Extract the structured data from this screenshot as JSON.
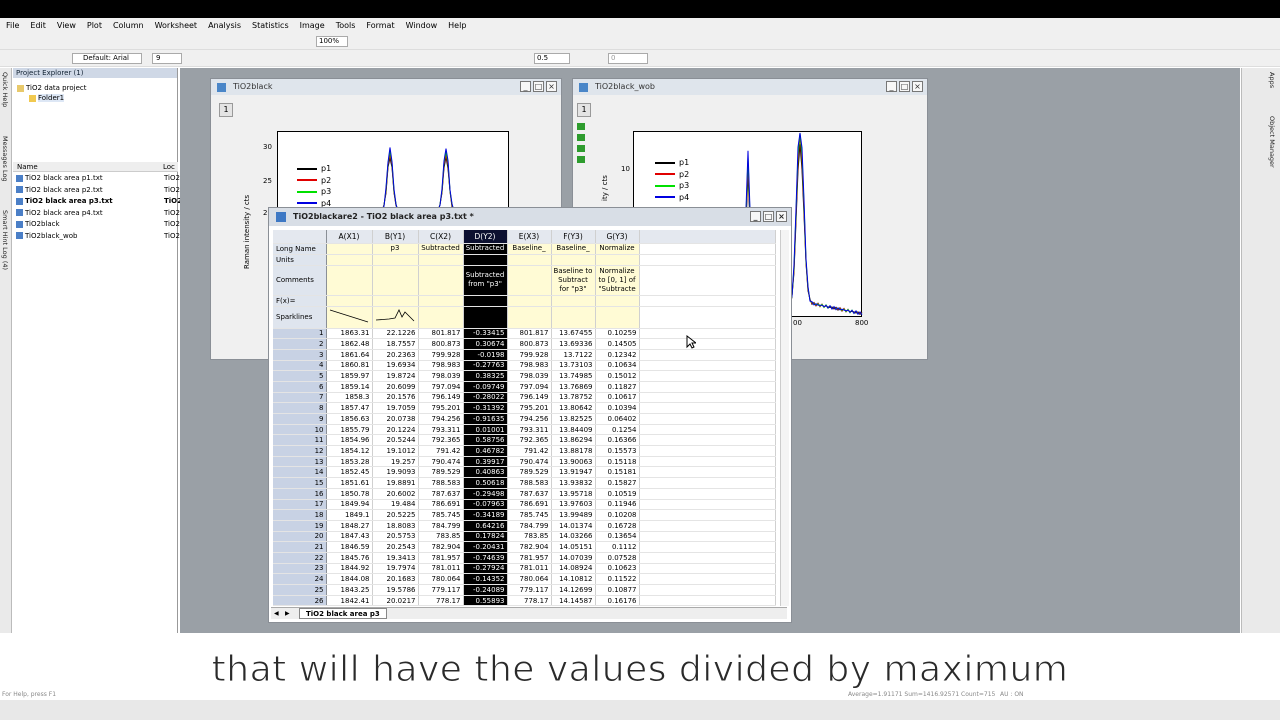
{
  "menu": [
    "File",
    "Edit",
    "View",
    "Plot",
    "Column",
    "Worksheet",
    "Analysis",
    "Statistics",
    "Image",
    "Tools",
    "Format",
    "Window",
    "Help"
  ],
  "toolbar": {
    "zoom": "100%",
    "font": "Default: Arial",
    "fontsize": "9",
    "linewidth": "0.5",
    "value": "0"
  },
  "side_labels": [
    "Quick Help",
    "Messages Log",
    "Smart Hint Log (4)"
  ],
  "right_labels": [
    "Apps",
    "Object Manager"
  ],
  "project_explorer": {
    "title": "Project Explorer (1)",
    "root": "TiO2 data project",
    "folder": "Folder1",
    "col_name": "Name",
    "col_loc": "Loc",
    "files": [
      {
        "name": "TiO2 black area p1.txt",
        "loc": "TiO2"
      },
      {
        "name": "TiO2 black area p2.txt",
        "loc": "TiO2"
      },
      {
        "name": "TiO2 black area p3.txt",
        "loc": "TiO2"
      },
      {
        "name": "TiO2 black area p4.txt",
        "loc": "TiO2"
      },
      {
        "name": "TiO2black",
        "loc": "TiO2"
      },
      {
        "name": "TiO2black_wob",
        "loc": "TiO2"
      }
    ]
  },
  "graph1": {
    "title": "TiO2black",
    "layer": "1",
    "ylabel": "Raman intensity / cts",
    "ticks": [
      "30",
      "25",
      "20"
    ],
    "legend": [
      "p1",
      "p2",
      "p3",
      "p4"
    ]
  },
  "graph2": {
    "title": "TiO2black_wob",
    "layer": "1",
    "ylabel": "ity / cts",
    "ticks": [
      "10"
    ],
    "xticks": [
      "00",
      "800"
    ],
    "legend": [
      "p1",
      "p2",
      "p3",
      "p4"
    ]
  },
  "colors": {
    "p1": "#000000",
    "p2": "#e00000",
    "p3": "#00e000",
    "p4": "#0000e0"
  },
  "worksheet": {
    "title": "TiO2blackare2 - TiO2 black area p3.txt *",
    "tab": "TiO2 black area p3",
    "columns": [
      "A(X1)",
      "B(Y1)",
      "C(X2)",
      "D(Y2)",
      "E(X3)",
      "F(Y3)",
      "G(Y3)"
    ],
    "row_labels": [
      "Long Name",
      "Units",
      "Comments",
      "F(x)=",
      "Sparklines"
    ],
    "long_names": [
      "",
      "p3",
      "Subtracted",
      "Subtracted",
      "Baseline_",
      "Baseline_",
      "Normalize"
    ],
    "comments": [
      "",
      "",
      "",
      "Subtracted from \"p3\"",
      "",
      "Baseline to Subtract for \"p3\"",
      "Normalize to [0, 1] of \"Subtracte"
    ],
    "rows": [
      [
        "1",
        "1863.31",
        "22.1226",
        "801.817",
        "-0.33415",
        "801.817",
        "13.67455",
        "0.10259"
      ],
      [
        "2",
        "1862.48",
        "18.7557",
        "800.873",
        "0.30674",
        "800.873",
        "13.69336",
        "0.14505"
      ],
      [
        "3",
        "1861.64",
        "20.2363",
        "799.928",
        "-0.0198",
        "799.928",
        "13.7122",
        "0.12342"
      ],
      [
        "4",
        "1860.81",
        "19.6934",
        "798.983",
        "-0.27763",
        "798.983",
        "13.73103",
        "0.10634"
      ],
      [
        "5",
        "1859.97",
        "19.8724",
        "798.039",
        "0.38325",
        "798.039",
        "13.74985",
        "0.15012"
      ],
      [
        "6",
        "1859.14",
        "20.6099",
        "797.094",
        "-0.09749",
        "797.094",
        "13.76869",
        "0.11827"
      ],
      [
        "7",
        "1858.3",
        "20.1576",
        "796.149",
        "-0.28022",
        "796.149",
        "13.78752",
        "0.10617"
      ],
      [
        "8",
        "1857.47",
        "19.7059",
        "795.201",
        "-0.31392",
        "795.201",
        "13.80642",
        "0.10394"
      ],
      [
        "9",
        "1856.63",
        "20.0738",
        "794.256",
        "-0.91635",
        "794.256",
        "13.82525",
        "0.06402"
      ],
      [
        "10",
        "1855.79",
        "20.1224",
        "793.311",
        "0.01001",
        "793.311",
        "13.84409",
        "0.1254"
      ],
      [
        "11",
        "1854.96",
        "20.5244",
        "792.365",
        "0.58756",
        "792.365",
        "13.86294",
        "0.16366"
      ],
      [
        "12",
        "1854.12",
        "19.1012",
        "791.42",
        "0.46782",
        "791.42",
        "13.88178",
        "0.15573"
      ],
      [
        "13",
        "1853.28",
        "19.257",
        "790.474",
        "0.39917",
        "790.474",
        "13.90063",
        "0.15118"
      ],
      [
        "14",
        "1852.45",
        "19.9093",
        "789.529",
        "0.40863",
        "789.529",
        "13.91947",
        "0.15181"
      ],
      [
        "15",
        "1851.61",
        "19.8891",
        "788.583",
        "0.50618",
        "788.583",
        "13.93832",
        "0.15827"
      ],
      [
        "16",
        "1850.78",
        "20.6002",
        "787.637",
        "-0.29498",
        "787.637",
        "13.95718",
        "0.10519"
      ],
      [
        "17",
        "1849.94",
        "19.484",
        "786.691",
        "-0.07963",
        "786.691",
        "13.97603",
        "0.11946"
      ],
      [
        "18",
        "1849.1",
        "20.5225",
        "785.745",
        "-0.34189",
        "785.745",
        "13.99489",
        "0.10208"
      ],
      [
        "19",
        "1848.27",
        "18.8083",
        "784.799",
        "0.64216",
        "784.799",
        "14.01374",
        "0.16728"
      ],
      [
        "20",
        "1847.43",
        "20.5753",
        "783.85",
        "0.17824",
        "783.85",
        "14.03266",
        "0.13654"
      ],
      [
        "21",
        "1846.59",
        "20.2543",
        "782.904",
        "-0.20431",
        "782.904",
        "14.05151",
        "0.1112"
      ],
      [
        "22",
        "1845.76",
        "19.3413",
        "781.957",
        "-0.74639",
        "781.957",
        "14.07039",
        "0.07528"
      ],
      [
        "23",
        "1844.92",
        "19.7974",
        "781.011",
        "-0.27924",
        "781.011",
        "14.08924",
        "0.10623"
      ],
      [
        "24",
        "1844.08",
        "20.1683",
        "780.064",
        "-0.14352",
        "780.064",
        "14.10812",
        "0.11522"
      ],
      [
        "25",
        "1843.25",
        "19.5786",
        "779.117",
        "-0.24089",
        "779.117",
        "14.12699",
        "0.10877"
      ],
      [
        "26",
        "1842.41",
        "20.0217",
        "778.17",
        "0.55893",
        "778.17",
        "14.14587",
        "0.16176"
      ]
    ]
  },
  "caption": "that will have the values divided by maximum",
  "status": {
    "left": "For Help, press F1",
    "right": "Average=1.91171 Sum=1416.92571 Count=715",
    "au": "AU : ON"
  }
}
